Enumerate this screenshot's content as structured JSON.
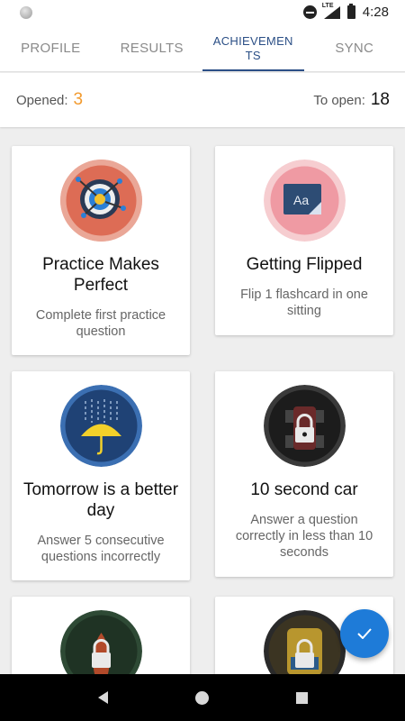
{
  "status": {
    "time": "4:28",
    "network": "LTE"
  },
  "tabs": [
    {
      "label": "PROFILE"
    },
    {
      "label": "RESULTS"
    },
    {
      "label": "ACHIEVEMEN\nTS"
    },
    {
      "label": "SYNC"
    }
  ],
  "counter": {
    "opened_label": "Opened:",
    "opened_value": "3",
    "to_open_label": "To open:",
    "to_open_value": "18"
  },
  "cards": [
    {
      "title": "Practice Makes Perfect",
      "desc": "Complete first practice question",
      "icon": "target-icon",
      "locked": false
    },
    {
      "title": "Getting Flipped",
      "desc": "Flip 1 flashcard in one sitting",
      "icon": "flashcard-icon",
      "locked": false
    },
    {
      "title": "Tomorrow is a better day",
      "desc": "Answer 5 consecutive questions incorrectly",
      "icon": "umbrella-icon",
      "locked": false
    },
    {
      "title": "10 second car",
      "desc": "Answer a question correctly in less than 10 seconds",
      "icon": "race-car-icon",
      "locked": true
    }
  ],
  "colors": {
    "accent": "#2b4f86",
    "opened": "#f29a2e",
    "fab": "#1e7bd8"
  }
}
